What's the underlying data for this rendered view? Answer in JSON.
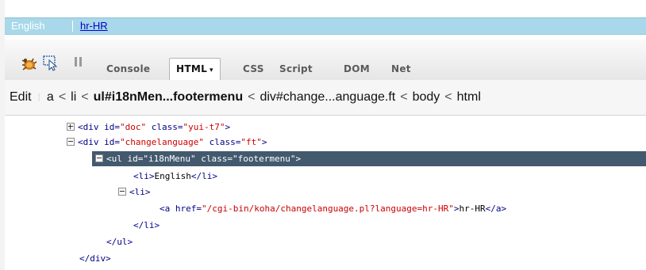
{
  "language_bar": {
    "current": "English",
    "link": "hr-HR"
  },
  "toolbar": {
    "icons": [
      "firebug-bug-icon",
      "inspect-icon",
      "pause-icon"
    ],
    "tabs": [
      {
        "label": "Console",
        "active": false
      },
      {
        "label": "HTML",
        "active": true
      },
      {
        "label": "CSS",
        "active": false
      },
      {
        "label": "Script",
        "active": false
      },
      {
        "label": "DOM",
        "active": false
      },
      {
        "label": "Net",
        "active": false
      }
    ],
    "active_caret": "▾"
  },
  "breadcrumb": {
    "edit": "Edit",
    "items": [
      "a",
      "li",
      "ul#i18nMen...footermenu",
      "div#change...anguage.ft",
      "body",
      "html"
    ],
    "separator": "<"
  },
  "tree": {
    "l1": {
      "open": "<div",
      "a1": "id=",
      "v1": "\"doc\"",
      "a2": "class=",
      "v2": "\"yui-t7\"",
      "close": ">"
    },
    "l2": {
      "open": "<div",
      "a1": "id=",
      "v1": "\"changelanguage\"",
      "a2": "class=",
      "v2": "\"ft\"",
      "close": ">"
    },
    "l3": {
      "open": "<ul",
      "a1": "id=",
      "v1": "\"i18nMenu\"",
      "a2": "class=",
      "v2": "\"footermenu\"",
      "close": ">"
    },
    "l4": {
      "open": "<li>",
      "text": "English",
      "close": "</li>"
    },
    "l5": {
      "open": "<li>"
    },
    "l6": {
      "open": "<a",
      "a1": "href=",
      "v1": "\"/cgi-bin/koha/changelanguage.pl?language=hr-HR\"",
      "close": ">",
      "text": "hr-HR",
      "end": "</a>"
    },
    "l7": {
      "close": "</li>"
    },
    "l8": {
      "close": "</ul>"
    },
    "l9": {
      "close": "</div>"
    }
  },
  "colors": {
    "language_bar": "#a8d8ea",
    "selection": "#435a6e",
    "tag": "#000088",
    "value": "#cc0000"
  }
}
